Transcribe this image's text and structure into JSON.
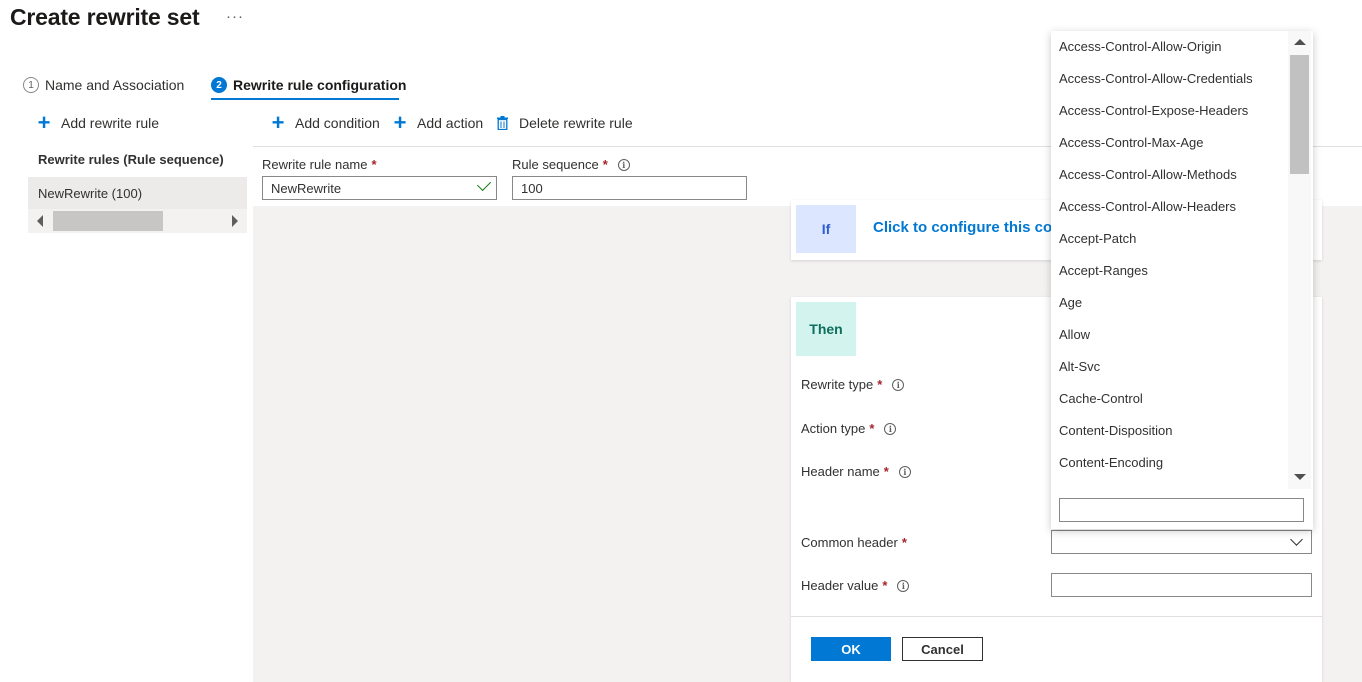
{
  "page": {
    "title": "Create rewrite set",
    "more_label": "···"
  },
  "tabs": [
    {
      "number": "1",
      "label": "Name and Association"
    },
    {
      "number": "2",
      "label": "Rewrite rule configuration"
    }
  ],
  "left_panel": {
    "add_rule_label": "Add rewrite rule",
    "heading": "Rewrite rules (Rule sequence)",
    "rules": [
      {
        "label": "NewRewrite (100)"
      }
    ]
  },
  "toolbar": {
    "add_condition": "Add condition",
    "add_action": "Add action",
    "delete_rule": "Delete rewrite rule"
  },
  "form": {
    "rule_name_label": "Rewrite rule name",
    "rule_name_value": "NewRewrite",
    "rule_sequence_label": "Rule sequence",
    "rule_sequence_value": "100",
    "required_mark": "*",
    "info_mark": "i"
  },
  "if_card": {
    "badge": "If",
    "link_text": "Click to configure this condition"
  },
  "then_card": {
    "badge": "Then",
    "rewrite_type_label": "Rewrite type",
    "action_type_label": "Action type",
    "header_name_label": "Header name",
    "common_header_label": "Common header",
    "header_value_label": "Header value",
    "ok_label": "OK",
    "cancel_label": "Cancel"
  },
  "dropdown": {
    "options": [
      "Access-Control-Allow-Origin",
      "Access-Control-Allow-Credentials",
      "Access-Control-Expose-Headers",
      "Access-Control-Max-Age",
      "Access-Control-Allow-Methods",
      "Access-Control-Allow-Headers",
      "Accept-Patch",
      "Accept-Ranges",
      "Age",
      "Allow",
      "Alt-Svc",
      "Cache-Control",
      "Content-Disposition",
      "Content-Encoding"
    ],
    "search_value": ""
  },
  "colors": {
    "accent": "#0078d4",
    "if_badge_bg": "#dce6ff",
    "then_badge_bg": "#d3f3ee",
    "required": "#a4262c"
  }
}
